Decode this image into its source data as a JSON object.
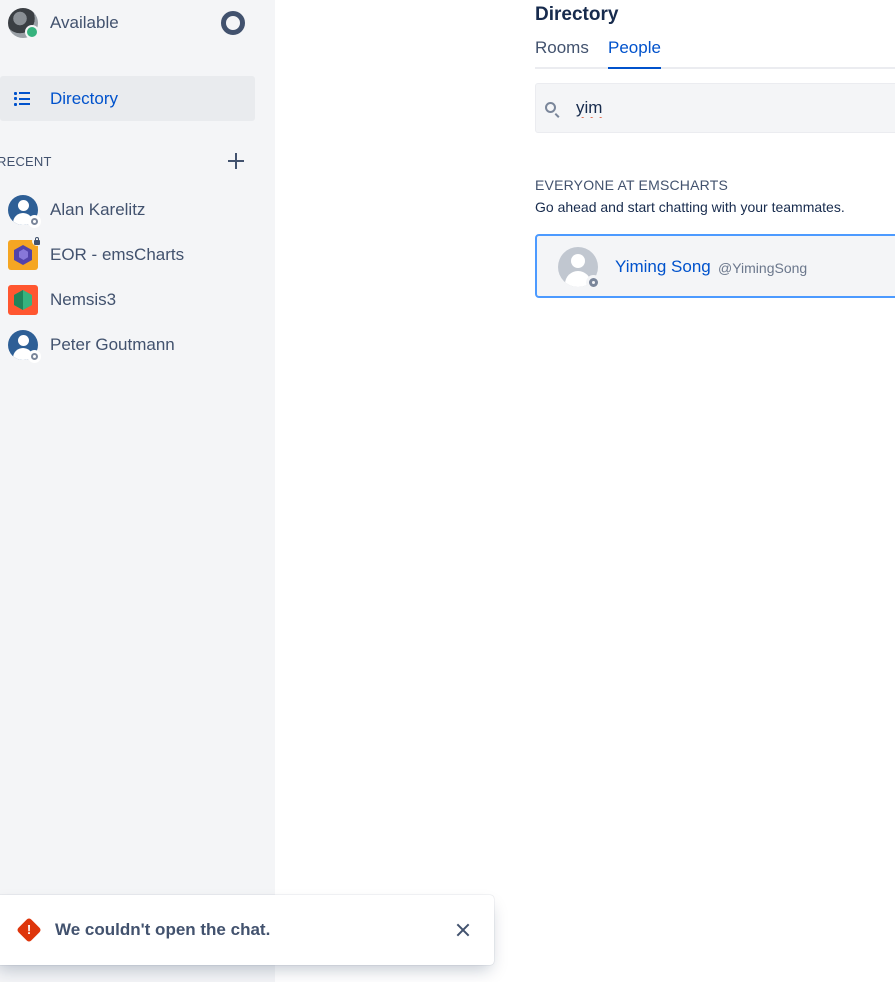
{
  "sidebar": {
    "status": {
      "label": "Available"
    },
    "nav": {
      "directory_label": "Directory"
    },
    "recent": {
      "title": "RECENT",
      "items": [
        {
          "label": "Alan Karelitz",
          "icon": "user-avatar-icon"
        },
        {
          "label": "EOR - emsCharts",
          "icon": "private-room-icon"
        },
        {
          "label": "Nemsis3",
          "icon": "room-icon"
        },
        {
          "label": "Peter Goutmann",
          "icon": "user-avatar-icon"
        }
      ]
    }
  },
  "main": {
    "title": "Directory",
    "tabs": [
      {
        "label": "Rooms"
      },
      {
        "label": "People",
        "active": true
      }
    ],
    "search": {
      "value": "yim"
    },
    "section": {
      "title": "EVERYONE AT EMSCHARTS",
      "subtitle": "Go ahead and start chatting with your teammates."
    },
    "results": [
      {
        "name": "Yiming Song",
        "handle": "@YimingSong"
      }
    ]
  },
  "toast": {
    "message": "We couldn't open the chat."
  },
  "colors": {
    "accent": "#0052cc",
    "error": "#de350b",
    "online": "#36b37e",
    "sidebar_bg": "#f4f5f7",
    "focus_border": "#4c9aff"
  }
}
